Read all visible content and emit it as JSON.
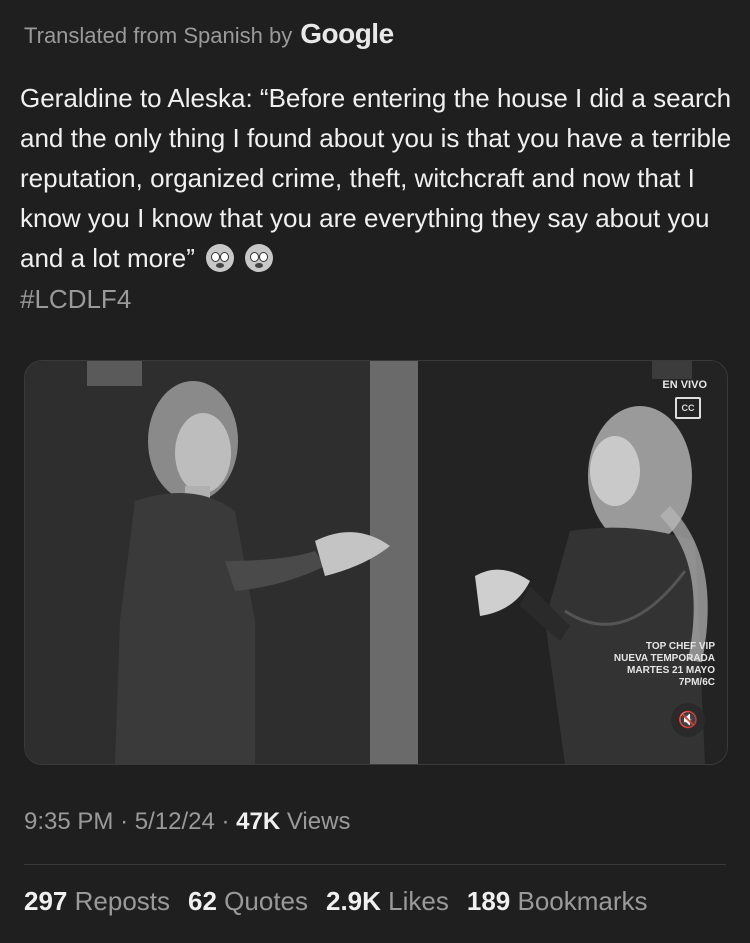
{
  "translation": {
    "prefix": "Translated from Spanish by",
    "provider": "Google"
  },
  "tweet": {
    "text": "Geraldine to Aleska: “Before entering the house I did a search and the only thing I found about you is that you have a terrible reputation, organized crime, theft, witchcraft and now that I know you I know that you are everything they say about you and a lot more”",
    "emojis": [
      "fearful-face-emoji",
      "flushed-face-emoji"
    ],
    "hashtag": "#LCDLF4"
  },
  "media": {
    "live_label": "EN VIVO",
    "cc_label": "CC",
    "promo_lines": [
      "TOP CHEF VIP",
      "NUEVA TEMPORADA",
      "MARTES 21 MAYO",
      "7PM/6C"
    ],
    "mute_icon": "speaker-muted-icon"
  },
  "meta": {
    "time": "9:35 PM",
    "date": "5/12/24",
    "views_count": "47K",
    "views_label": "Views"
  },
  "stats": {
    "reposts_count": "297",
    "reposts_label": "Reposts",
    "quotes_count": "62",
    "quotes_label": "Quotes",
    "likes_count": "2.9K",
    "likes_label": "Likes",
    "bookmarks_count": "189",
    "bookmarks_label": "Bookmarks"
  }
}
